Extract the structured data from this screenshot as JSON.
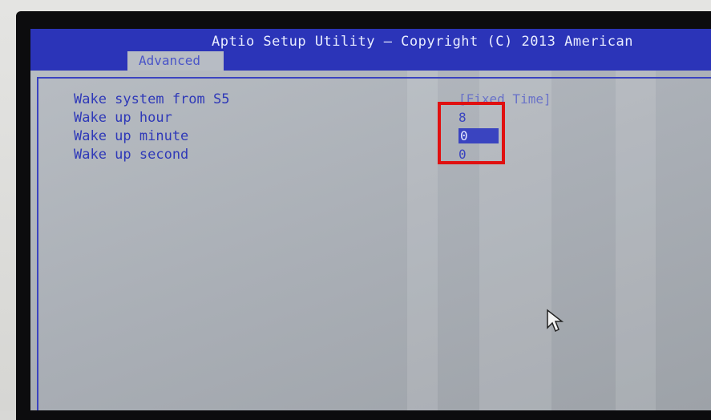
{
  "bios": {
    "title": "Aptio Setup Utility – Copyright (C) 2013 American",
    "active_tab": "Advanced"
  },
  "settings": [
    {
      "label": "Wake system from S5",
      "value": "[Fixed Time]"
    },
    {
      "label": "Wake up hour",
      "value": "8"
    },
    {
      "label": "Wake up minute",
      "value": "0"
    },
    {
      "label": "Wake up second",
      "value": "0"
    }
  ],
  "colors": {
    "header_blue": "#2b34b8",
    "screen_gray": "#b9bec4",
    "highlight_red": "#e01010"
  },
  "icons": {
    "cursor": "mouse-pointer-icon"
  }
}
